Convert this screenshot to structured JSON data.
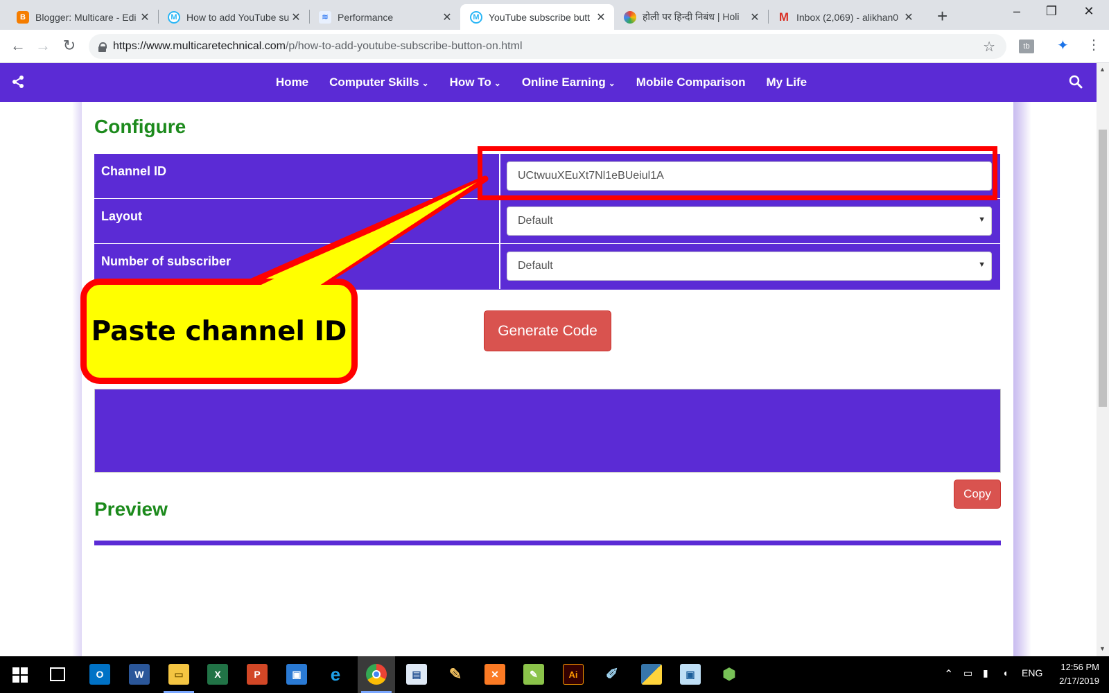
{
  "browser": {
    "tabs": [
      {
        "title": "Blogger: Multicare - Edi",
        "icon": "blogger-icon",
        "color": "#f57d00"
      },
      {
        "title": "How to add YouTube su",
        "icon": "multicare-icon",
        "color": "#29b6f6"
      },
      {
        "title": "Performance",
        "icon": "performance-icon",
        "color": "#4285f4"
      },
      {
        "title": "YouTube subscribe butt",
        "icon": "multicare-icon",
        "color": "#29b6f6",
        "active": true
      },
      {
        "title": "होली पर हिन्दी निबंध | Holi",
        "icon": "site-icon",
        "color": "#ea4335"
      },
      {
        "title": "Inbox (2,069) - alikhan0",
        "icon": "gmail-icon",
        "color": "#d93025"
      }
    ],
    "new_tab": "+",
    "url_host": "https://www.multicaretechnical.com",
    "url_path": "/p/how-to-add-youtube-subscribe-button-on.html",
    "window_controls": {
      "minimize": "–",
      "restore": "❐",
      "close": "✕"
    }
  },
  "site": {
    "nav": [
      {
        "label": "Home",
        "dropdown": false
      },
      {
        "label": "Computer Skills",
        "dropdown": true
      },
      {
        "label": "How To",
        "dropdown": true
      },
      {
        "label": "Online Earning",
        "dropdown": true
      },
      {
        "label": "Mobile Comparison",
        "dropdown": false
      },
      {
        "label": "My Life",
        "dropdown": false
      }
    ],
    "brand_color": "#5b2bd5"
  },
  "configure": {
    "heading": "Configure",
    "rows": [
      {
        "label": "Channel ID",
        "value": "UCtwuuXEuXt7Nl1eBUeiul1A",
        "type": "text"
      },
      {
        "label": "Layout",
        "value": "Default",
        "type": "select"
      },
      {
        "label": "Number of subscriber",
        "value": "Default",
        "type": "select"
      }
    ],
    "generate_label": "Generate Code"
  },
  "output": {
    "copy_label": "Copy"
  },
  "preview": {
    "heading": "Preview"
  },
  "annotation": {
    "callout_text": "Paste channel ID",
    "colors": {
      "fill": "#ffff00",
      "stroke": "#ff0000"
    }
  },
  "taskbar": {
    "apps": [
      "outlook-icon",
      "word-icon",
      "file-explorer-icon",
      "excel-icon",
      "powerpoint-icon",
      "remote-desktop-icon",
      "internet-explorer-icon",
      "chrome-icon",
      "notepad-icon",
      "paint-icon",
      "xampp-icon",
      "notepad-plus-icon",
      "illustrator-icon",
      "pen-icon",
      "python-icon",
      "virtualbox-icon",
      "android-studio-icon"
    ],
    "language": "ENG",
    "time": "12:56 PM",
    "date": "2/17/2019"
  }
}
